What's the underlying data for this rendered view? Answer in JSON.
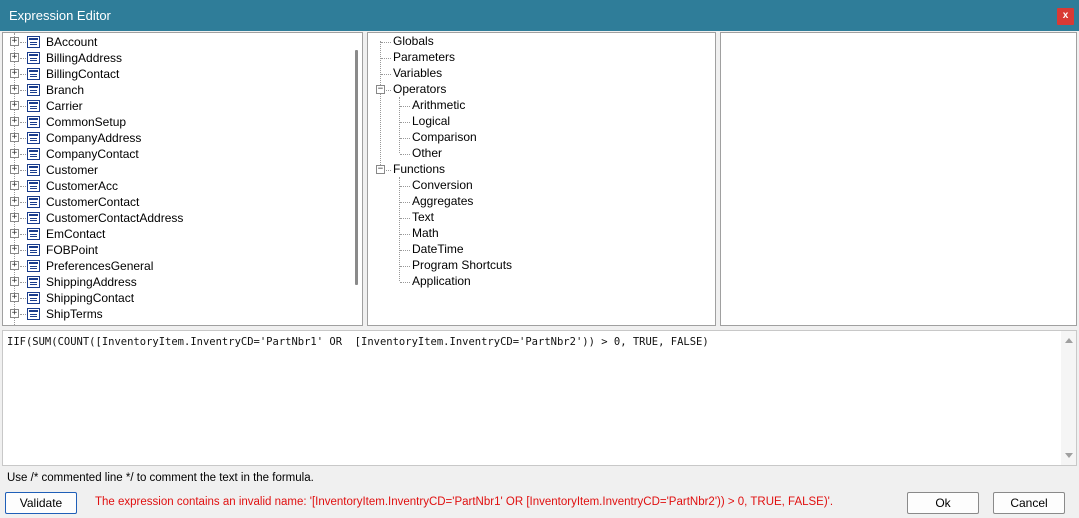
{
  "window": {
    "title": "Expression Editor",
    "close_label": "x"
  },
  "fields_tree": {
    "items": [
      "BAccount",
      "BillingAddress",
      "BillingContact",
      "Branch",
      "Carrier",
      "CommonSetup",
      "CompanyAddress",
      "CompanyContact",
      "Customer",
      "CustomerAcc",
      "CustomerContact",
      "CustomerContactAddress",
      "EmContact",
      "FOBPoint",
      "PreferencesGeneral",
      "ShippingAddress",
      "ShippingContact",
      "ShipTerms"
    ]
  },
  "category_tree": {
    "globals": "Globals",
    "parameters": "Parameters",
    "variables": "Variables",
    "operators": {
      "label": "Operators",
      "expander": "−",
      "children": [
        "Arithmetic",
        "Logical",
        "Comparison",
        "Other"
      ]
    },
    "functions": {
      "label": "Functions",
      "expander": "−",
      "children": [
        "Conversion",
        "Aggregates",
        "Text",
        "Math",
        "DateTime",
        "Program Shortcuts",
        "Application"
      ]
    }
  },
  "editor": {
    "expression": "IIF(SUM(COUNT([InventoryItem.InventryCD='PartNbr1' OR  [InventoryItem.InventryCD='PartNbr2')) > 0, TRUE, FALSE)"
  },
  "hint": "Use /* commented line */ to comment the text in the formula.",
  "footer": {
    "validate_label": "Validate",
    "error_message": "The expression contains an invalid name: '[InventoryItem.InventryCD='PartNbr1' OR  [InventoryItem.InventryCD='PartNbr2')) > 0, TRUE, FALSE)'.",
    "ok_label": "Ok",
    "cancel_label": "Cancel"
  },
  "colors": {
    "titlebar": "#2f7d99",
    "close": "#d93a35",
    "error": "#e01010"
  }
}
